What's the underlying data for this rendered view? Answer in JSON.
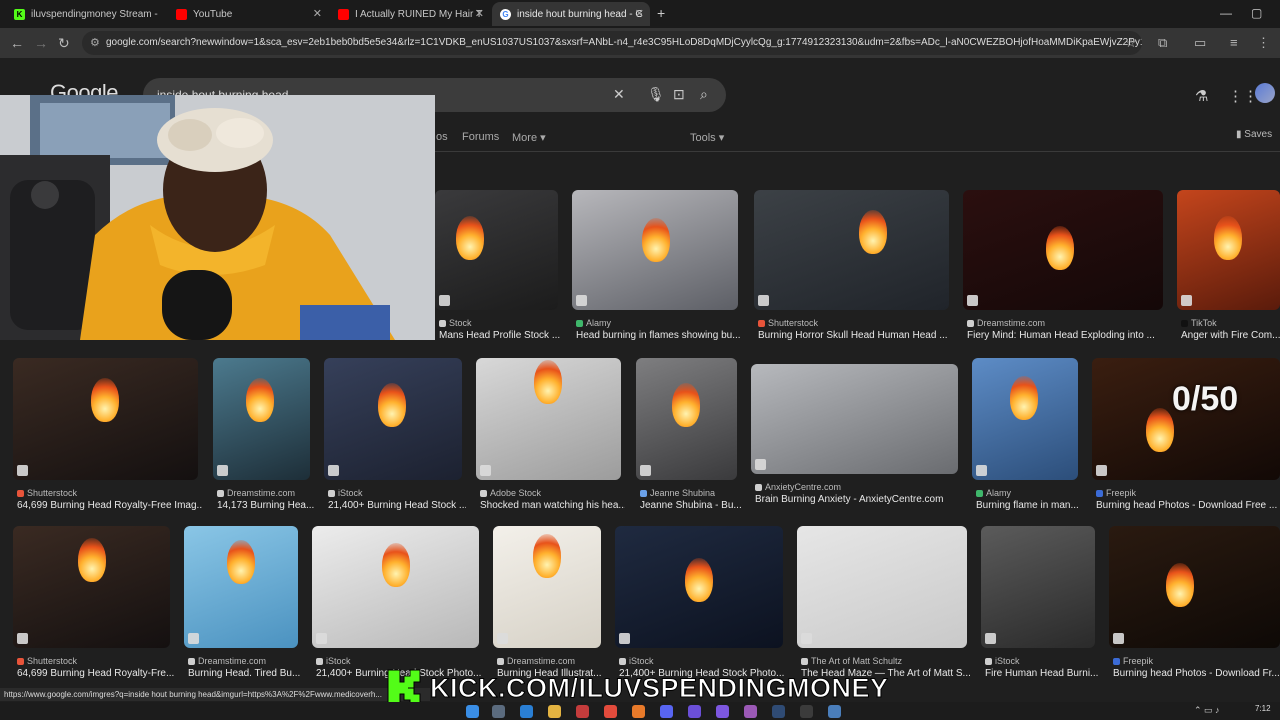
{
  "tabs": [
    {
      "label": "iluvspendingmoney Stream - W",
      "favicon_color": "#53fc18"
    },
    {
      "label": "YouTube",
      "favicon_color": "#ff0000"
    },
    {
      "label": "I Actually RUINED My Hair This",
      "favicon_color": "#ff0000"
    },
    {
      "label": "inside hout burning head - Goo",
      "favicon_color": "#4285f4"
    }
  ],
  "new_tab": "+",
  "address_url": "google.com/search?newwindow=1&sca_esv=2eb1beb0bd5e5e34&rlz=1C1VDKB_enUS1037US1037&sxsrf=ANbL-n4_r4e3C95HLoD8DqMDjCyylcQg_g:1774912323130&udm=2&fbs=ADc_l-aN0CWEZBOHjofHoaMMDiKpaEWjvZ2Py1XXV8d8...",
  "google": {
    "logo": "Google",
    "search_value": "inside hout burning head",
    "filters": [
      "os",
      "Forums",
      "More ▾",
      "Tools ▾"
    ],
    "saves": "Saves"
  },
  "results": [
    {
      "source": "Stock",
      "title": "Mans Head Profile Stock ...",
      "favicon": "#cfcfcf"
    },
    {
      "source": "Alamy",
      "title": "Head burning in flames showing bu...",
      "favicon": "#3fb76b"
    },
    {
      "source": "Shutterstock",
      "title": "Burning Horror Skull Head Human Head ...",
      "favicon": "#e8543a"
    },
    {
      "source": "Dreamstime.com",
      "title": "Fiery Mind: Human Head Exploding into ...",
      "favicon": "#cfcfcf"
    },
    {
      "source": "TikTok",
      "title": "Anger with Fire Com...",
      "favicon": "#111111"
    },
    {
      "source": "Shutterstock",
      "title": "64,699 Burning Head Royalty-Free Imag...",
      "favicon": "#e8543a"
    },
    {
      "source": "Dreamstime.com",
      "title": "14,173 Burning Hea...",
      "favicon": "#cfcfcf"
    },
    {
      "source": "iStock",
      "title": "21,400+ Burning Head Stock ...",
      "favicon": "#cfcfcf"
    },
    {
      "source": "Adobe Stock",
      "title": "Shocked man watching his hea...",
      "favicon": "#cfcfcf"
    },
    {
      "source": "Jeanne Shubina",
      "title": "Jeanne Shubina - Bu...",
      "favicon": "#6aa0e8"
    },
    {
      "source": "AnxietyCentre.com",
      "title": "Brain Burning Anxiety - AnxietyCentre.com",
      "favicon": "#cfcfcf"
    },
    {
      "source": "Alamy",
      "title": "Burning flame in man...",
      "favicon": "#3fb76b"
    },
    {
      "source": "Freepik",
      "title": "Burning head Photos - Download Free ...",
      "favicon": "#3b6bd6"
    },
    {
      "source": "Shutterstock",
      "title": "64,699 Burning Head Royalty-Fre...",
      "favicon": "#e8543a"
    },
    {
      "source": "Dreamstime.com",
      "title": "Burning Head. Tired Bu...",
      "favicon": "#cfcfcf"
    },
    {
      "source": "iStock",
      "title": "21,400+ Burning Head Stock Photo...",
      "favicon": "#cfcfcf"
    },
    {
      "source": "Dreamstime.com",
      "title": "Burning Head Illustrat...",
      "favicon": "#cfcfcf"
    },
    {
      "source": "iStock",
      "title": "21,400+ Burning Head Stock Photo...",
      "favicon": "#cfcfcf"
    },
    {
      "source": "The Art of Matt Schultz",
      "title": "The Head Maze — The Art of Matt S...",
      "favicon": "#cfcfcf"
    },
    {
      "source": "iStock",
      "title": "Fire Human Head Burni...",
      "favicon": "#cfcfcf"
    },
    {
      "source": "Freepik",
      "title": "Burning head Photos - Download Fr...",
      "favicon": "#3b6bd6"
    }
  ],
  "overlay": {
    "counter": "0/50",
    "kick_text": "KICK.COM/ILUVSPENDINGMONEY",
    "status_url": "https://www.google.com/imgres?q=inside hout burning head&imgurl=https%3A%2F%2Fwww.medicoverh..."
  },
  "clock": "7:12"
}
